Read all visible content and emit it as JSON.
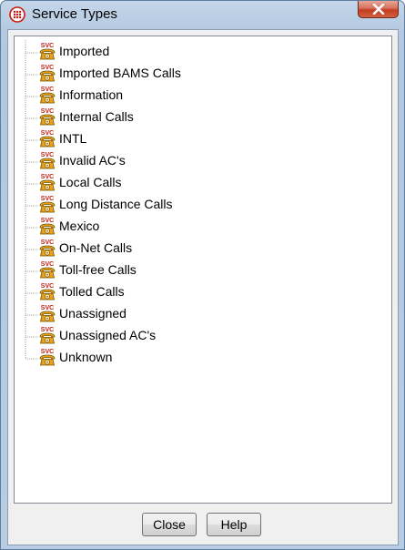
{
  "window": {
    "title": "Service Types",
    "close_glyph": "X"
  },
  "tree": {
    "icon_name": "svc-phone-icon",
    "icon_caption": "SVC",
    "items": [
      "Imported",
      "Imported BAMS Calls",
      "Information",
      "Internal Calls",
      "INTL",
      "Invalid AC's",
      "Local Calls",
      "Long Distance Calls",
      "Mexico",
      "On-Net Calls",
      "Toll-free Calls",
      "Tolled Calls",
      "Unassigned",
      "Unassigned AC's",
      "Unknown"
    ]
  },
  "buttons": {
    "close_label": "Close",
    "help_label": "Help"
  },
  "colors": {
    "title_bar": "#b8cde3",
    "close_button": "#c9442a",
    "icon_phone": "#e8a21c",
    "icon_caption": "#cc1a10"
  }
}
